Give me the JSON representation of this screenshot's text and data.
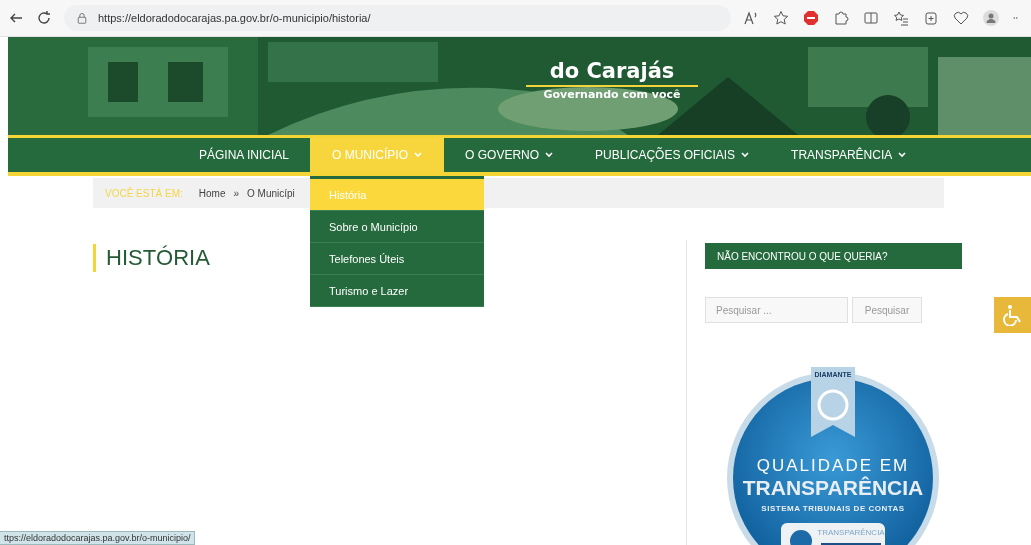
{
  "browser": {
    "url": "https://eldoradodocarajas.pa.gov.br/o-municipio/historia/"
  },
  "logo": {
    "subtitle": "do Carajás",
    "tagline": "Governando com você"
  },
  "nav": {
    "items": [
      {
        "label": "PÁGINA INICIAL",
        "selected": false,
        "has_dropdown": false
      },
      {
        "label": "O MUNICÍPIO",
        "selected": true,
        "has_dropdown": true
      },
      {
        "label": "O GOVERNO",
        "selected": false,
        "has_dropdown": true
      },
      {
        "label": "PUBLICAÇÕES OFICIAIS",
        "selected": false,
        "has_dropdown": true
      },
      {
        "label": "TRANSPARÊNCIA",
        "selected": false,
        "has_dropdown": true
      }
    ]
  },
  "dropdown": {
    "items": [
      {
        "label": "História",
        "selected": true
      },
      {
        "label": "Sobre o Município",
        "selected": false
      },
      {
        "label": "Telefones Úteis",
        "selected": false
      },
      {
        "label": "Turismo e Lazer",
        "selected": false
      }
    ]
  },
  "breadcrumb": {
    "label": "VOCÊ ESTÁ EM:",
    "separator": "»",
    "items": [
      "Home",
      "O Municípi"
    ]
  },
  "page_title": "HISTÓRIA",
  "sidebar": {
    "title": "NÃO ENCONTROU O QUE QUERIA?",
    "search": {
      "placeholder": "Pesquisar ...",
      "button": "Pesquisar"
    },
    "badge": {
      "ribbon": "DIAMANTE",
      "line_1": "QUALIDADE EM",
      "line_2": "TRANSPARÊNCIA",
      "line_3": "SISTEMA TRIBUNAIS DE CONTAS",
      "footer_small": "TRANSPARÊNCIA"
    }
  },
  "status_url": "ttps://eldoradodocarajas.pa.gov.br/o-municipio/"
}
